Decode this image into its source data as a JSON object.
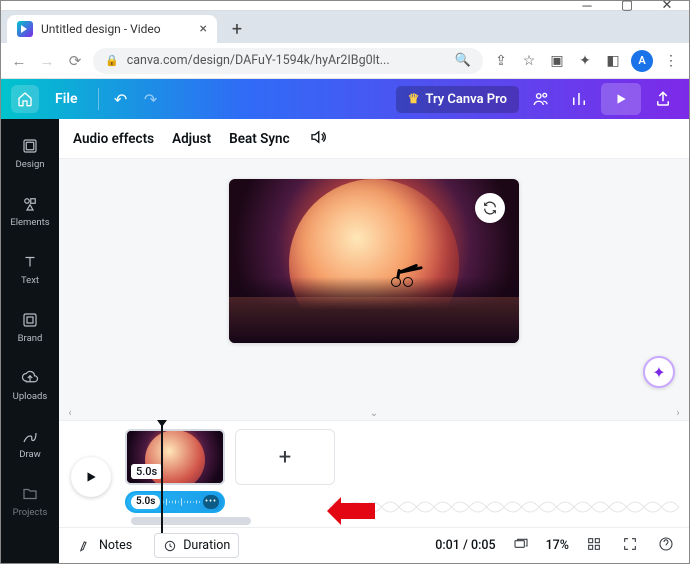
{
  "window": {
    "tab_title": "Untitled design - Video",
    "url_display": "canva.com/design/DAFuY-1594k/hyAr2IBg0lt...",
    "avatar_letter": "A"
  },
  "canva_header": {
    "file_label": "File",
    "try_pro_label": "Try Canva Pro"
  },
  "siderail": {
    "items": [
      {
        "label": "Design"
      },
      {
        "label": "Elements"
      },
      {
        "label": "Text"
      },
      {
        "label": "Brand"
      },
      {
        "label": "Uploads"
      },
      {
        "label": "Draw"
      },
      {
        "label": "Projects"
      }
    ]
  },
  "audio_toolbar": {
    "effects": "Audio effects",
    "adjust": "Adjust",
    "beatsync": "Beat Sync"
  },
  "timeline": {
    "video_clip_duration": "5.0s",
    "audio_clip_duration": "5.0s",
    "add_page_glyph": "+"
  },
  "bottombar": {
    "notes_label": "Notes",
    "duration_label": "Duration",
    "time_display": "0:01 / 0:05",
    "zoom_label": "17%"
  }
}
